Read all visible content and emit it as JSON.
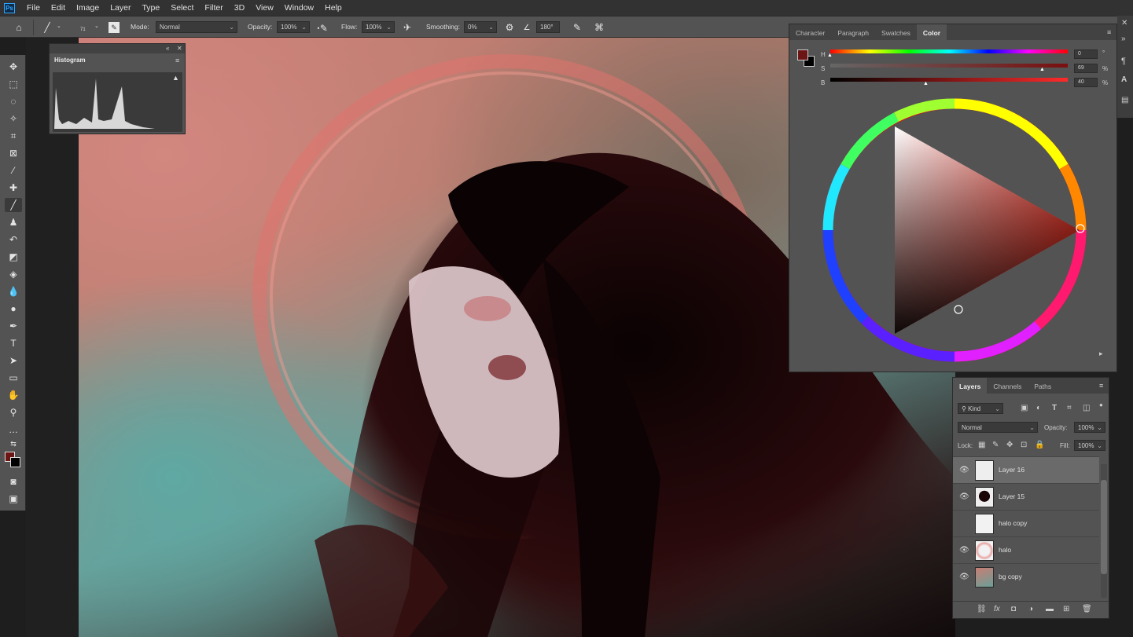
{
  "menu": [
    "File",
    "Edit",
    "Image",
    "Layer",
    "Type",
    "Select",
    "Filter",
    "3D",
    "View",
    "Window",
    "Help"
  ],
  "options": {
    "brush_size": "71",
    "mode_label": "Mode:",
    "mode_value": "Normal",
    "opacity_label": "Opacity:",
    "opacity_value": "100%",
    "flow_label": "Flow:",
    "flow_value": "100%",
    "smoothing_label": "Smoothing:",
    "smoothing_value": "0%",
    "angle_value": "180°"
  },
  "histogram": {
    "title": "Histogram"
  },
  "color_panel": {
    "tabs": [
      "Character",
      "Paragraph",
      "Swatches",
      "Color"
    ],
    "h_label": "H",
    "h_value": "0",
    "s_label": "S",
    "s_value": "69",
    "b_label": "B",
    "b_value": "40",
    "deg": "°",
    "pct": "%",
    "foreground": "#6b1515",
    "background": "#000000"
  },
  "layers_panel": {
    "tabs": [
      "Layers",
      "Channels",
      "Paths"
    ],
    "filter_label": "Kind",
    "blend_mode": "Normal",
    "opacity_label": "Opacity:",
    "opacity_value": "100%",
    "lock_label": "Lock:",
    "fill_label": "Fill:",
    "fill_value": "100%",
    "layers": [
      {
        "name": "Layer 16",
        "visible": true,
        "selected": true
      },
      {
        "name": "Layer 15",
        "visible": true,
        "selected": false
      },
      {
        "name": "halo copy",
        "visible": false,
        "selected": false
      },
      {
        "name": "halo",
        "visible": true,
        "selected": false
      },
      {
        "name": "bg copy",
        "visible": true,
        "selected": false
      }
    ]
  }
}
